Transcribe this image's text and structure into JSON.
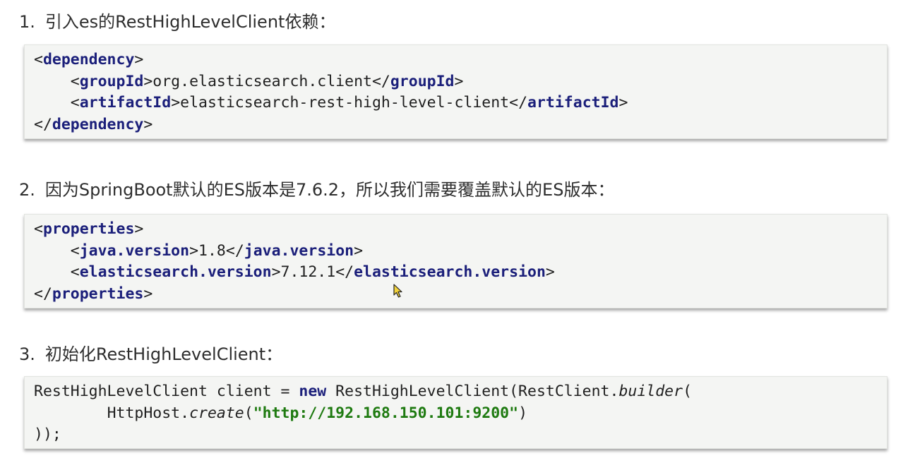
{
  "sections": [
    {
      "number": "1.",
      "title": "引入es的RestHighLevelClient依赖：",
      "code": {
        "line1": {
          "lt": "<",
          "tag": "dependency",
          "gt": ">"
        },
        "line2": {
          "indent": "    ",
          "lt": "<",
          "tag": "groupId",
          "gt": ">",
          "value": "org.elasticsearch.client",
          "close_lt": "</",
          "close_tag": "groupId",
          "close_gt": ">"
        },
        "line3": {
          "indent": "    ",
          "lt": "<",
          "tag": "artifactId",
          "gt": ">",
          "value": "elasticsearch-rest-high-level-client",
          "close_lt": "</",
          "close_tag": "artifactId",
          "close_gt": ">"
        },
        "line4": {
          "lt": "</",
          "tag": "dependency",
          "gt": ">"
        }
      }
    },
    {
      "number": "2.",
      "title": "因为SpringBoot默认的ES版本是7.6.2，所以我们需要覆盖默认的ES版本：",
      "code": {
        "line1": {
          "lt": "<",
          "tag": "properties",
          "gt": ">"
        },
        "line2": {
          "indent": "    ",
          "lt": "<",
          "tag": "java.version",
          "gt": ">",
          "value": "1.8",
          "close_lt": "</",
          "close_tag": "java.version",
          "close_gt": ">"
        },
        "line3": {
          "indent": "    ",
          "lt": "<",
          "tag": "elasticsearch.version",
          "gt": ">",
          "value": "7.12.1",
          "close_lt": "</",
          "close_tag": "elasticsearch.version",
          "close_gt": ">"
        },
        "line4": {
          "lt": "</",
          "tag": "properties",
          "gt": ">"
        }
      }
    },
    {
      "number": "3.",
      "title": "初始化RestHighLevelClient：",
      "code": {
        "line1": {
          "a": "RestHighLevelClient client = ",
          "kw": "new",
          "b": " RestHighLevelClient(RestClient.",
          "method": "builder",
          "c": "("
        },
        "line2": {
          "indent": "        ",
          "a": "HttpHost.",
          "method": "create",
          "b": "(",
          "str": "\"http://192.168.150.101:9200\"",
          "c": ")"
        },
        "line3": {
          "a": "));"
        }
      }
    }
  ],
  "colors": {
    "tag": "#1b1f7a",
    "string": "#1e7a10",
    "code_bg": "#f4f5f3"
  },
  "cursor_icon": "mouse-pointer-icon"
}
